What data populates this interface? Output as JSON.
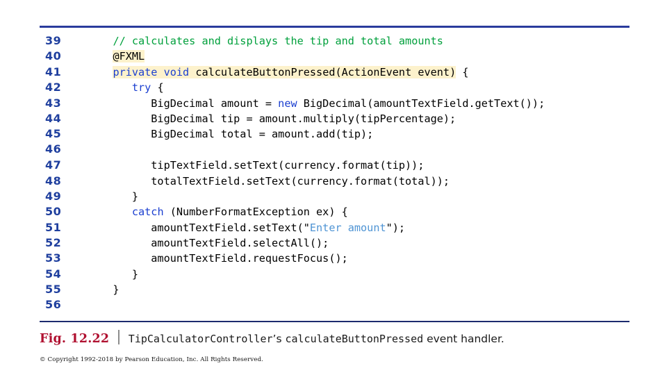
{
  "figure": {
    "label": "Fig. 12.22",
    "caption_mono_1": "TipCalculatorController",
    "caption_apostrophe": "’s ",
    "caption_mono_2": "calculateButtonPressed",
    "caption_tail": " event handler."
  },
  "copyright": "© Copyright 1992-2018 by Pearson Education, Inc. All Rights Reserved.",
  "colors": {
    "rule_top": "#2a3b9c",
    "rule_bottom": "#1c2a6e",
    "line_number": "#1f3f9e",
    "keyword": "#1b3fd0",
    "comment": "#00a03c",
    "string": "#4f94d4",
    "highlight": "#fdf2cc",
    "figure_label": "#b01030",
    "code_text": "#000000"
  },
  "code": {
    "language": "java",
    "first_line": 39,
    "last_line": 56,
    "lines": [
      {
        "n": "39",
        "text": "   // calculates and displays the tip and total amounts"
      },
      {
        "n": "40",
        "text": "   @FXML"
      },
      {
        "n": "41",
        "text": "   private void calculateButtonPressed(ActionEvent event) {"
      },
      {
        "n": "42",
        "text": "      try {"
      },
      {
        "n": "43",
        "text": "         BigDecimal amount = new BigDecimal(amountTextField.getText());"
      },
      {
        "n": "44",
        "text": "         BigDecimal tip = amount.multiply(tipPercentage);"
      },
      {
        "n": "45",
        "text": "         BigDecimal total = amount.add(tip);"
      },
      {
        "n": "46",
        "text": ""
      },
      {
        "n": "47",
        "text": "         tipTextField.setText(currency.format(tip));"
      },
      {
        "n": "48",
        "text": "         totalTextField.setText(currency.format(total));"
      },
      {
        "n": "49",
        "text": "      }"
      },
      {
        "n": "50",
        "text": "      catch (NumberFormatException ex) {"
      },
      {
        "n": "51",
        "text": "         amountTextField.setText(\"Enter amount\");"
      },
      {
        "n": "52",
        "text": "         amountTextField.selectAll();"
      },
      {
        "n": "53",
        "text": "         amountTextField.requestFocus();"
      },
      {
        "n": "54",
        "text": "      }"
      },
      {
        "n": "55",
        "text": "   }"
      },
      {
        "n": "56",
        "text": ""
      }
    ],
    "tokens": {
      "l39": [
        {
          "t": "   ",
          "c": "plain"
        },
        {
          "t": "// calculates and displays the tip and total amounts",
          "c": "comment"
        }
      ],
      "l40": [
        {
          "t": "   ",
          "c": "plain"
        },
        {
          "t": "@FXML",
          "c": "plain",
          "hl": true
        }
      ],
      "l41": [
        {
          "t": "   ",
          "c": "plain"
        },
        {
          "t": "private",
          "c": "kw",
          "hl": true
        },
        {
          "t": " ",
          "c": "plain",
          "hl": true
        },
        {
          "t": "void",
          "c": "kw",
          "hl": true
        },
        {
          "t": " calculateButtonPressed(ActionEvent event)",
          "c": "plain",
          "hl": true
        },
        {
          "t": " {",
          "c": "plain"
        }
      ],
      "l42": [
        {
          "t": "      ",
          "c": "plain"
        },
        {
          "t": "try",
          "c": "kw"
        },
        {
          "t": " {",
          "c": "plain"
        }
      ],
      "l43": [
        {
          "t": "         BigDecimal amount = ",
          "c": "plain"
        },
        {
          "t": "new",
          "c": "kw"
        },
        {
          "t": " BigDecimal(amountTextField.getText());",
          "c": "plain"
        }
      ],
      "l44": [
        {
          "t": "         BigDecimal tip = amount.multiply(tipPercentage);",
          "c": "plain"
        }
      ],
      "l45": [
        {
          "t": "         BigDecimal total = amount.add(tip);",
          "c": "plain"
        }
      ],
      "l46": [
        {
          "t": "",
          "c": "plain"
        }
      ],
      "l47": [
        {
          "t": "         tipTextField.setText(currency.format(tip));",
          "c": "plain"
        }
      ],
      "l48": [
        {
          "t": "         totalTextField.setText(currency.format(total));",
          "c": "plain"
        }
      ],
      "l49": [
        {
          "t": "      }",
          "c": "plain"
        }
      ],
      "l50": [
        {
          "t": "      ",
          "c": "plain"
        },
        {
          "t": "catch",
          "c": "kw"
        },
        {
          "t": " (NumberFormatException ex) {",
          "c": "plain"
        }
      ],
      "l51": [
        {
          "t": "         amountTextField.setText(\"",
          "c": "plain"
        },
        {
          "t": "Enter amount",
          "c": "str"
        },
        {
          "t": "\");",
          "c": "plain"
        }
      ],
      "l52": [
        {
          "t": "         amountTextField.selectAll();",
          "c": "plain"
        }
      ],
      "l53": [
        {
          "t": "         amountTextField.requestFocus();",
          "c": "plain"
        }
      ],
      "l54": [
        {
          "t": "      }",
          "c": "plain"
        }
      ],
      "l55": [
        {
          "t": "   }",
          "c": "plain"
        }
      ],
      "l56": [
        {
          "t": "",
          "c": "plain"
        }
      ]
    }
  }
}
